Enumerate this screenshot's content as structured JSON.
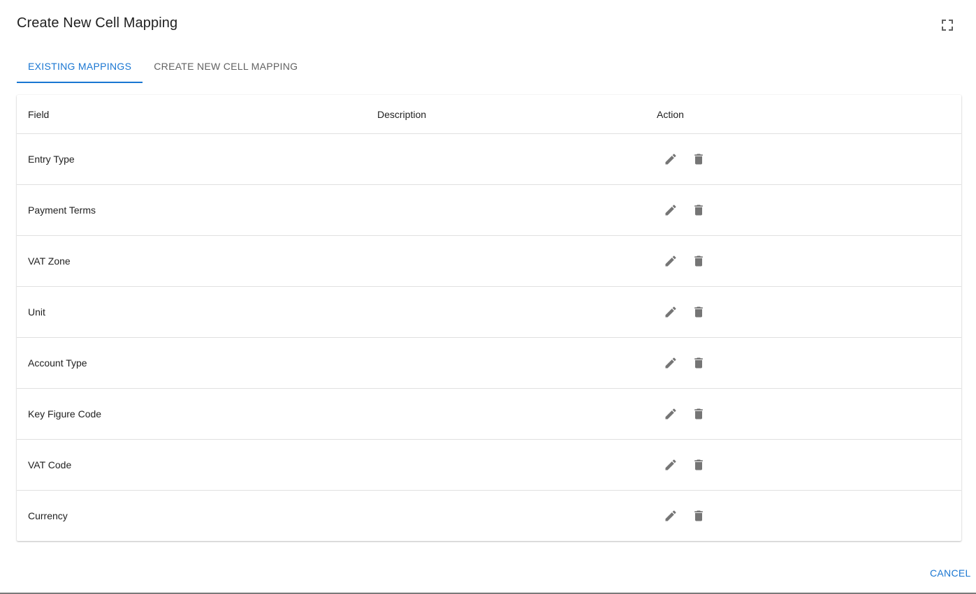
{
  "dialog": {
    "title": "Create New Cell Mapping"
  },
  "tabs": [
    {
      "label": "EXISTING MAPPINGS",
      "active": true
    },
    {
      "label": "CREATE NEW CELL MAPPING",
      "active": false
    }
  ],
  "table": {
    "headers": {
      "field": "Field",
      "description": "Description",
      "action": "Action"
    },
    "rows": [
      {
        "field": "Entry Type",
        "description": ""
      },
      {
        "field": "Payment Terms",
        "description": ""
      },
      {
        "field": "VAT Zone",
        "description": ""
      },
      {
        "field": "Unit",
        "description": ""
      },
      {
        "field": "Account Type",
        "description": ""
      },
      {
        "field": "Key Figure Code",
        "description": ""
      },
      {
        "field": "VAT Code",
        "description": ""
      },
      {
        "field": "Currency",
        "description": ""
      }
    ]
  },
  "footer": {
    "cancel_label": "CANCEL"
  },
  "icons": {
    "fullscreen": "fullscreen-icon",
    "edit": "pencil-icon",
    "delete": "trash-icon"
  },
  "colors": {
    "accent": "#1976d2",
    "icon": "#757575"
  }
}
